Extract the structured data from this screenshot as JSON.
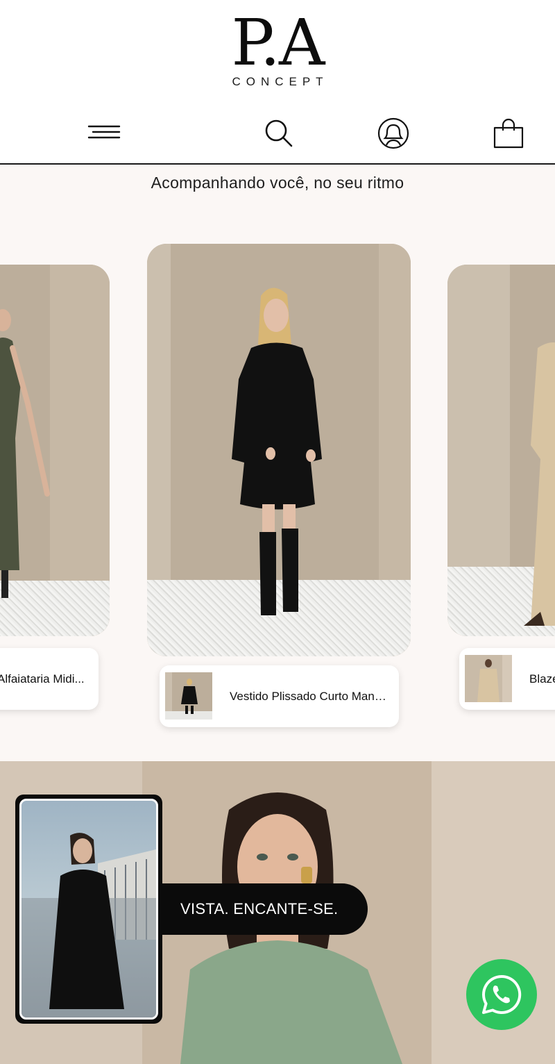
{
  "header": {
    "logo_main": "P.A",
    "logo_sub": "CONCEPT",
    "icons": [
      "menu-icon",
      "search-icon",
      "account-icon",
      "bag-icon"
    ]
  },
  "tagline": "Acompanhando você, no seu ritmo",
  "carousel": {
    "items": [
      {
        "label": "Alfaiataria Midi...",
        "position": "left"
      },
      {
        "label": "Vestido Plissado Curto Mang...",
        "position": "center"
      },
      {
        "label": "Blaze",
        "position": "right"
      }
    ]
  },
  "hero": {
    "banner_text": "VISTA. ENCANTE-SE."
  },
  "colors": {
    "accent_whatsapp": "#2ec55f",
    "background": "#fbf7f5",
    "dark": "#0b0b0b"
  }
}
